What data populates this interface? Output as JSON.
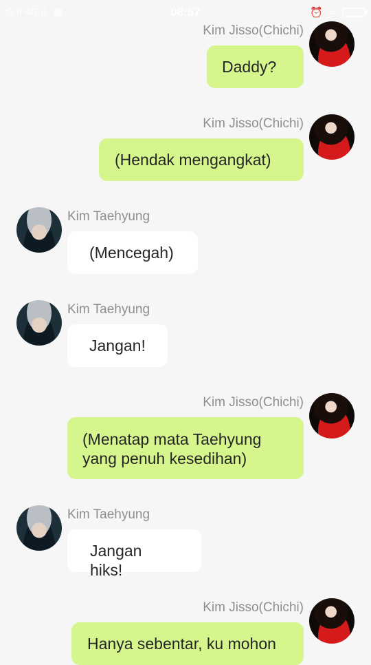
{
  "status_bar": {
    "signal_text": "G.ıl 4G.ıl",
    "time": "08:57"
  },
  "messages": [
    {
      "sender": "Kim Jisso(Chichi)",
      "side": "right",
      "text": "Daddy?"
    },
    {
      "sender": "Kim Jisso(Chichi)",
      "side": "right",
      "text": "(Hendak mengangkat)"
    },
    {
      "sender": "Kim Taehyung",
      "side": "left",
      "text": "(Mencegah)"
    },
    {
      "sender": "Kim Taehyung",
      "side": "left",
      "text": "Jangan!"
    },
    {
      "sender": "Kim Jisso(Chichi)",
      "side": "right",
      "text": "(Menatap mata Taehyung yang penuh kesedihan)"
    },
    {
      "sender": "Kim Taehyung",
      "side": "left",
      "text": "Jangan hiks!"
    },
    {
      "sender": "Kim Jisso(Chichi)",
      "side": "right",
      "text": "Hanya sebentar, ku mohon"
    }
  ],
  "colors": {
    "sent_bubble": "#d5f58d",
    "received_bubble": "#ffffff",
    "background": "#f6f6f6"
  }
}
